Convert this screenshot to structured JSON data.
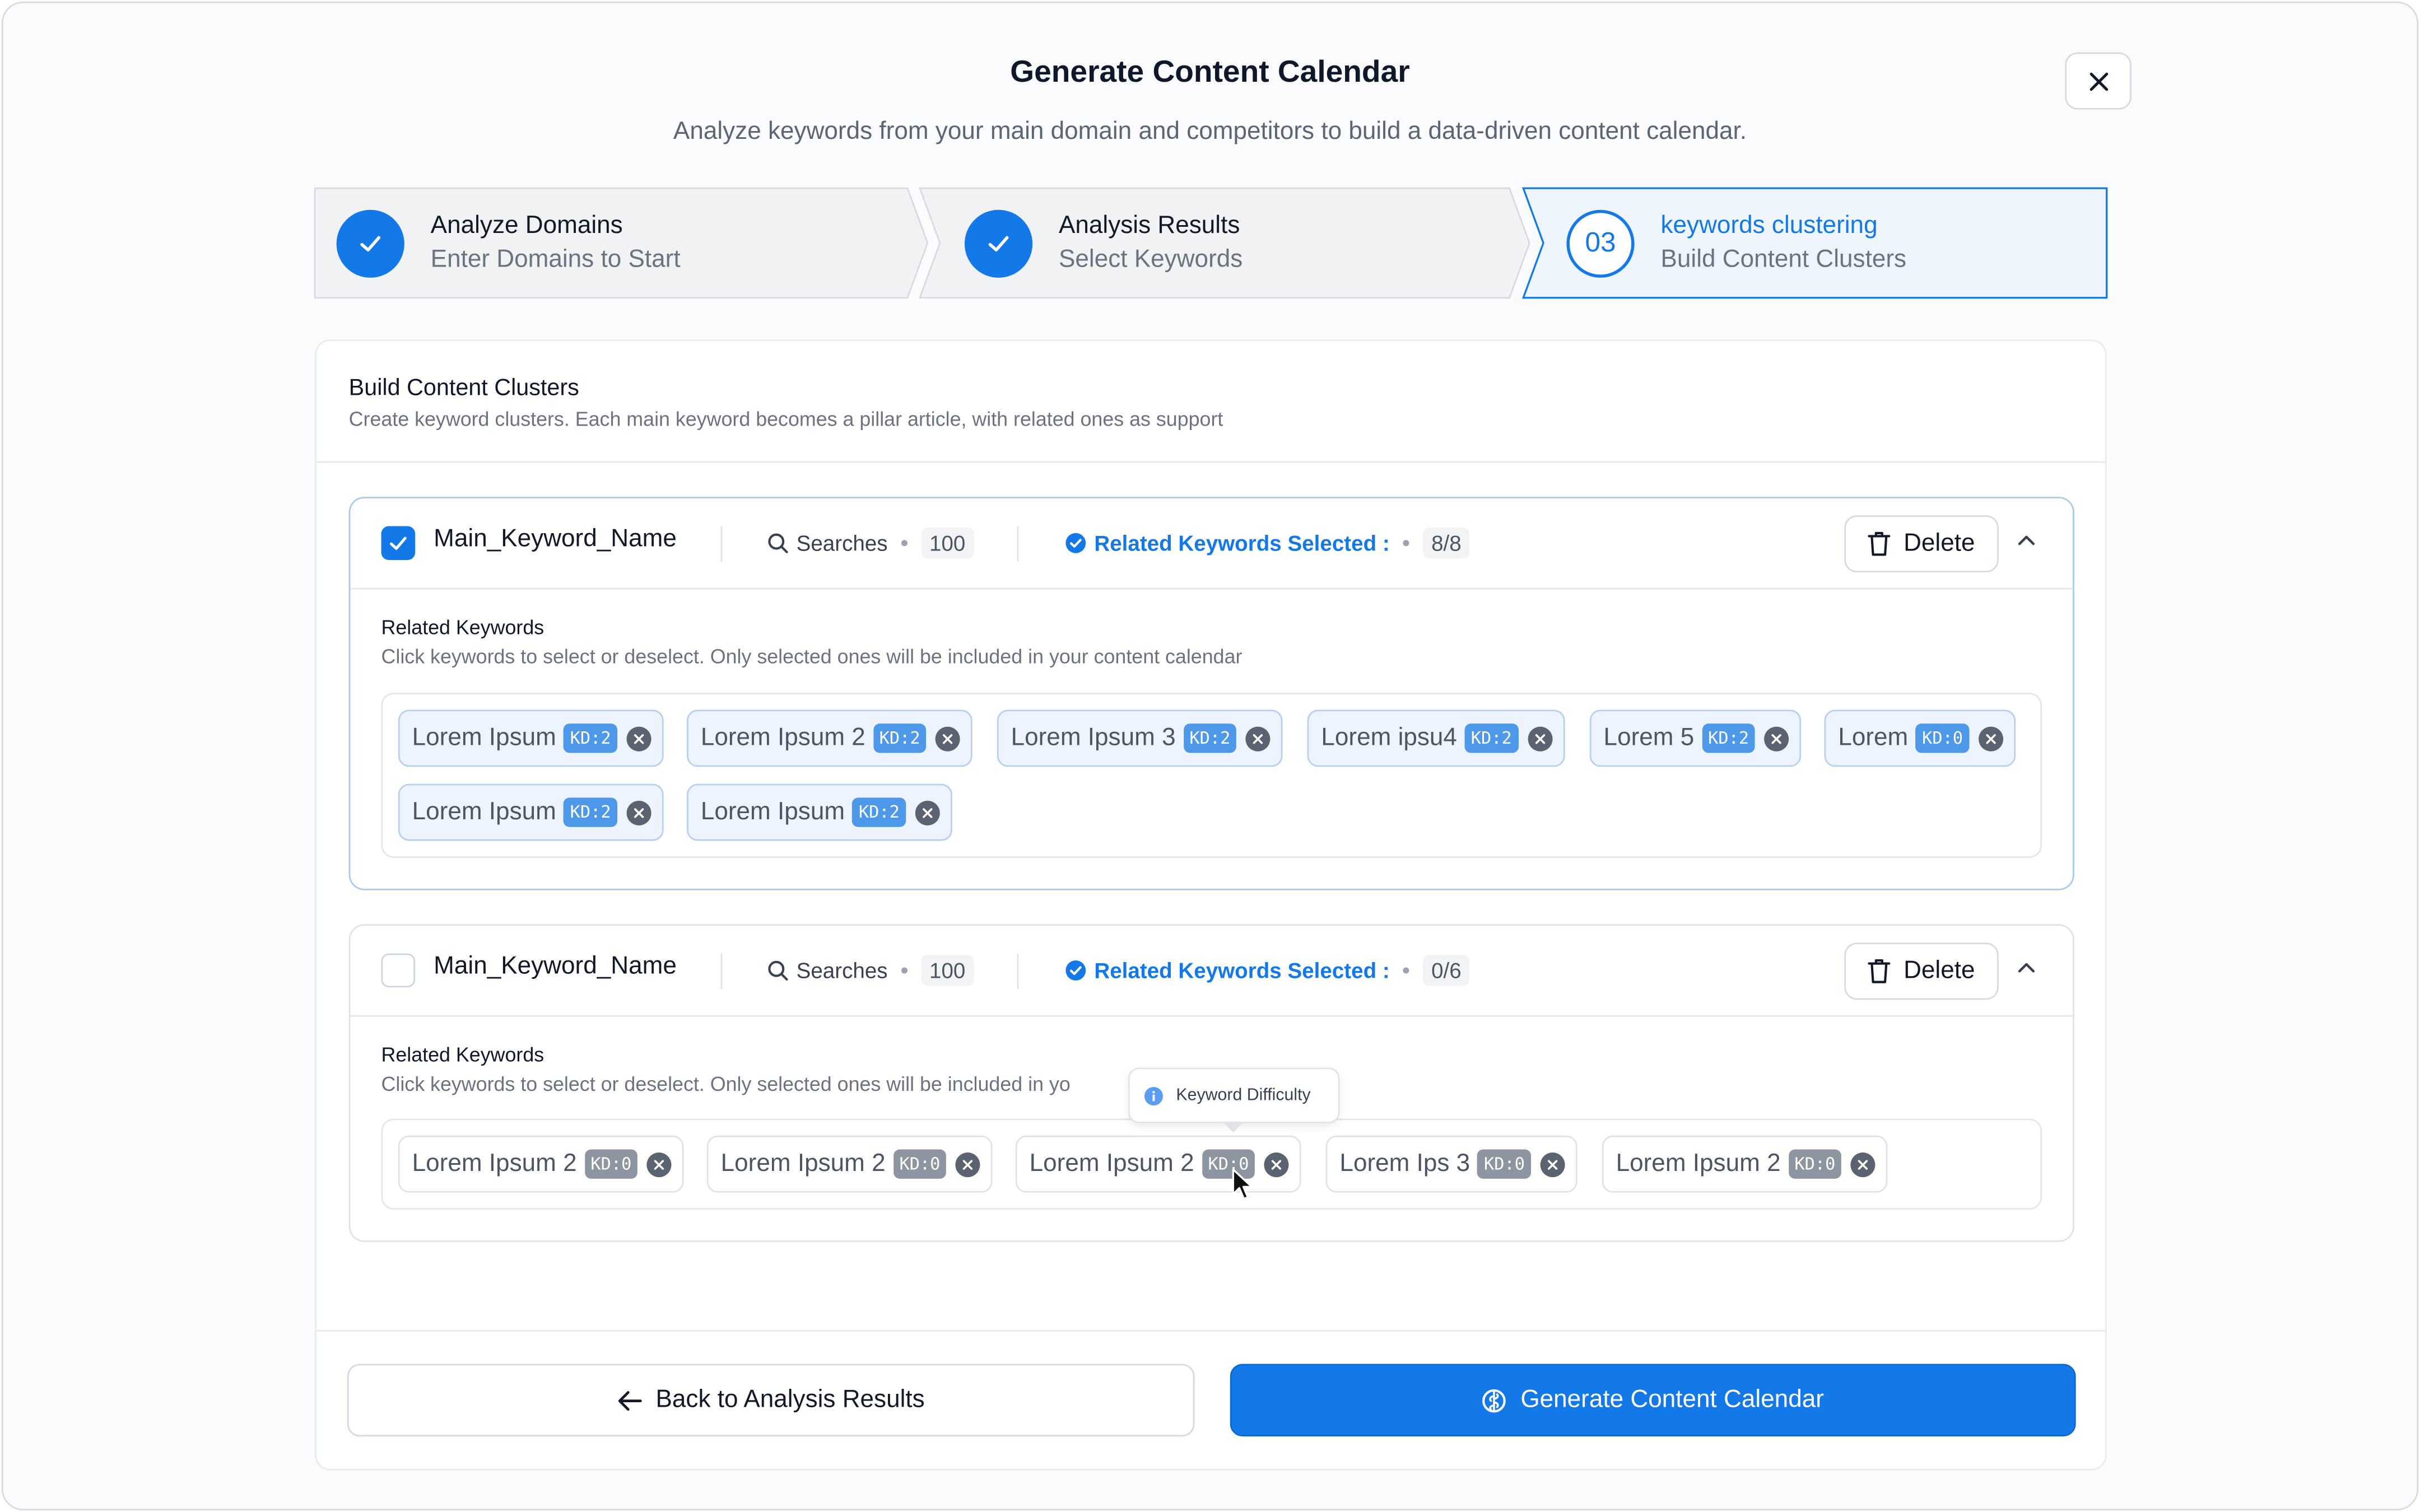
{
  "modal": {
    "title": "Generate Content Calendar",
    "subtitle": "Analyze keywords from your main domain and competitors to build a data-driven content calendar.",
    "close_icon": "x-icon"
  },
  "stepper": {
    "steps": [
      {
        "title": "Analyze Domains",
        "subtitle": "Enter Domains to Start",
        "status": "complete"
      },
      {
        "title": "Analysis Results",
        "subtitle": "Select Keywords",
        "status": "complete"
      },
      {
        "title": "keywords clustering",
        "subtitle": "Build Content Clusters",
        "status": "active",
        "number": "03"
      }
    ]
  },
  "panel": {
    "title": "Build Content Clusters",
    "description": "Create keyword clusters. Each main keyword becomes a pillar article, with related ones as support"
  },
  "clusters": [
    {
      "checked": true,
      "name": "Main_Keyword_Name",
      "searches_label": "Searches",
      "searches": "100",
      "related_label": "Related Keywords Selected :",
      "related_count": "8/8",
      "delete_label": "Delete",
      "related_title": "Related Keywords",
      "related_desc": "Click keywords to select or deselect. Only selected ones will be included in your content calendar",
      "keywords": [
        {
          "text": "Lorem Ipsum",
          "kd": "KD:2"
        },
        {
          "text": "Lorem Ipsum 2",
          "kd": "KD:2"
        },
        {
          "text": "Lorem Ipsum 3",
          "kd": "KD:2"
        },
        {
          "text": "Lorem ipsu4",
          "kd": "KD:2"
        },
        {
          "text": "Lorem 5",
          "kd": "KD:2"
        },
        {
          "text": "Lorem",
          "kd": "KD:0"
        },
        {
          "text": "Lorem Ipsum",
          "kd": "KD:2"
        },
        {
          "text": "Lorem Ipsum",
          "kd": "KD:2"
        }
      ]
    },
    {
      "checked": false,
      "name": "Main_Keyword_Name",
      "searches_label": "Searches",
      "searches": "100",
      "related_label": "Related Keywords Selected :",
      "related_count": "0/6",
      "delete_label": "Delete",
      "related_title": "Related Keywords",
      "related_desc": "Click keywords to select or deselect. Only selected ones will be included in yo",
      "keywords": [
        {
          "text": "Lorem Ipsum 2",
          "kd": "KD:0"
        },
        {
          "text": "Lorem Ipsum 2",
          "kd": "KD:0"
        },
        {
          "text": "Lorem Ipsum 2",
          "kd": "KD:0"
        },
        {
          "text": "Lorem Ips 3",
          "kd": "KD:0"
        },
        {
          "text": "Lorem Ipsum 2",
          "kd": "KD:0"
        }
      ]
    }
  ],
  "tooltip": {
    "text": "Keyword Difficulty",
    "icon": "info-icon"
  },
  "footer": {
    "back_label": "Back to Analysis Results",
    "generate_label": "Generate Content Calendar"
  },
  "colors": {
    "accent": "#1379e8",
    "accent_light": "#eef4fd",
    "kd_badge_selected": "#4e98ea",
    "kd_badge_unselected": "#8d95a0"
  }
}
